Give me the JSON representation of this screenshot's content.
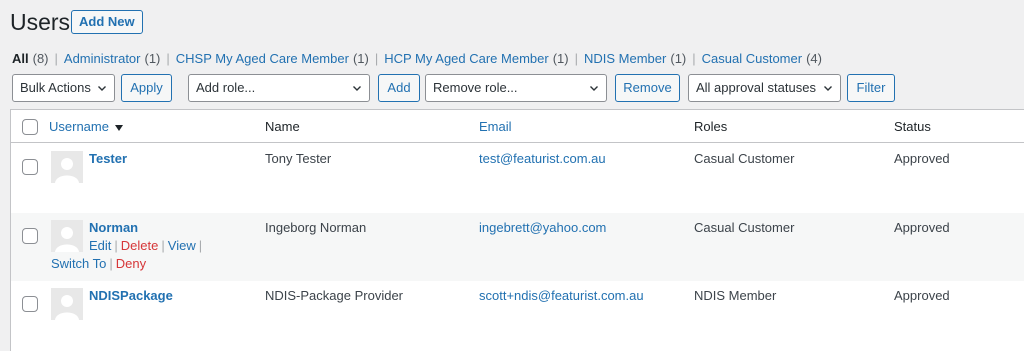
{
  "header": {
    "title": "Users",
    "add_new": "Add New"
  },
  "filters": [
    {
      "label": "All",
      "count": "(8)",
      "current": true
    },
    {
      "label": "Administrator",
      "count": "(1)"
    },
    {
      "label": "CHSP My Aged Care Member",
      "count": "(1)"
    },
    {
      "label": "HCP My Aged Care Member",
      "count": "(1)"
    },
    {
      "label": "NDIS Member",
      "count": "(1)"
    },
    {
      "label": "Casual Customer",
      "count": "(4)"
    }
  ],
  "controls": {
    "bulk_actions": "Bulk Actions",
    "apply": "Apply",
    "add_role": "Add role...",
    "add": "Add",
    "remove_role": "Remove role...",
    "remove": "Remove",
    "approval_status": "All approval statuses",
    "filter": "Filter"
  },
  "table": {
    "columns": {
      "username": "Username",
      "name": "Name",
      "email": "Email",
      "roles": "Roles",
      "status": "Status"
    },
    "rows": [
      {
        "username": "Tester",
        "name": "Tony Tester",
        "email": "test@featurist.com.au",
        "roles": "Casual Customer",
        "status": "Approved"
      },
      {
        "username": "Norman",
        "name": "Ingeborg Norman",
        "email": "ingebrett@yahoo.com",
        "roles": "Casual Customer",
        "status": "Approved",
        "actions": {
          "edit": "Edit",
          "delete": "Delete",
          "view": "View",
          "switch_to": "Switch To",
          "deny": "Deny"
        }
      },
      {
        "username": "NDISPackage",
        "name": "NDIS-Package Provider",
        "email": "scott+ndis@featurist.com.au",
        "roles": "NDIS Member",
        "status": "Approved"
      }
    ]
  },
  "colors": {
    "link": "#2271b1",
    "danger": "#d63638",
    "text": "#1d2327",
    "background": "#f0f0f1"
  }
}
